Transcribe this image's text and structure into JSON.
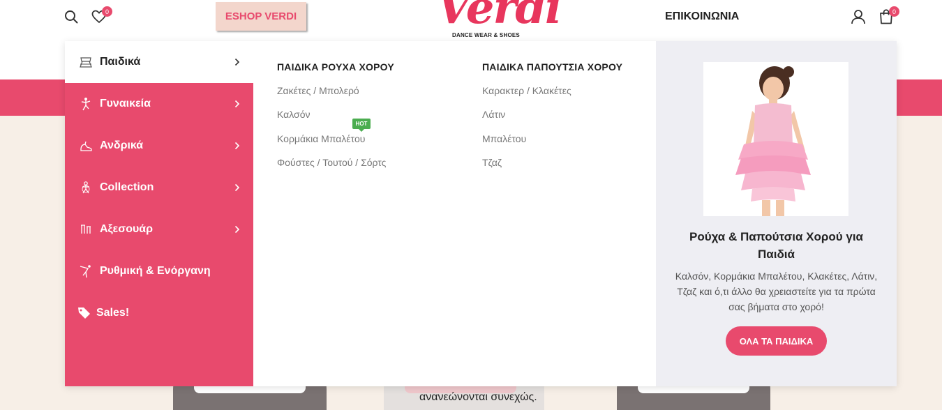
{
  "header": {
    "wishlist_count": "0",
    "cart_count": "0",
    "eshop_label": "ESHOP VERDI",
    "logo_text": "Verdi",
    "logo_tagline": "DANCE WEAR & SHOES",
    "contact_label": "ΕΠΙΚΟΙΝΩΝΙΑ"
  },
  "sidebar": {
    "items": [
      {
        "label": "Παιδικά",
        "icon": "kids-dress-icon",
        "has_submenu": true,
        "active": true
      },
      {
        "label": "Γυναικεία",
        "icon": "female-dancer-icon",
        "has_submenu": true
      },
      {
        "label": "Ανδρικά",
        "icon": "dance-shoe-icon",
        "has_submenu": true
      },
      {
        "label": "Collection",
        "icon": "collection-icon",
        "has_submenu": true
      },
      {
        "label": "Αξεσουάρ",
        "icon": "accessories-icon",
        "has_submenu": true
      },
      {
        "label": "Ρυθμική & Ενόργανη",
        "icon": "gymnast-icon",
        "has_submenu": false
      },
      {
        "label": "Sales!",
        "icon": "tag-icon",
        "has_submenu": false
      }
    ]
  },
  "columns": [
    {
      "title": "ΠΑΙΔΙΚΑ ΡΟΥΧΑ ΧΟΡΟΥ",
      "links": [
        "Ζακέτες / Μπολερό",
        "Καλσόν",
        "Κορμάκια Μπαλέτου",
        "Φούστες / Τουτού / Σόρτς"
      ]
    },
    {
      "title": "ΠΑΙΔΙΚΑ ΠΑΠΟΥΤΣΙΑ ΧΟΡΟΥ",
      "links": [
        "Καρακτερ / Κλακέτες",
        "Λάτιν",
        "Μπαλέτου",
        "Τζαζ"
      ]
    }
  ],
  "hot_badge": "HOT",
  "promo": {
    "title": "Ρούχα & Παπούτσια Χορού για Παιδιά",
    "description": "Καλσόν, Κορμάκια Μπαλέτου, Κλακέτες, Λάτιν, Τζαζ και ό,τι άλλο θα χρειαστείτε για τα πρώτα σας βήματα στο χορό!",
    "button_label": "ΟΛΑ ΤΑ ΠΑΙΔΙΚΑ"
  },
  "background": {
    "partial_text": "ανανεώνονται συνεχώς."
  },
  "colors": {
    "brand": "#e84a6d",
    "hot_badge": "#4bad50",
    "promo_bg": "#eeeef3"
  }
}
